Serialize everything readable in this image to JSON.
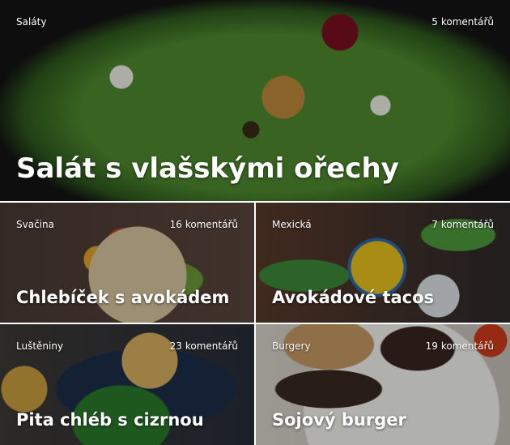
{
  "cards": [
    {
      "category": "Saláty",
      "comments_count": "5",
      "comments_word": "komentářů",
      "title": "Salát s vlašskými ořechy"
    },
    {
      "category": "Svačina",
      "comments_count": "16",
      "comments_word": "komentářů",
      "title": "Chlebíček s avokádem"
    },
    {
      "category": "Mexická",
      "comments_count": "7",
      "comments_word": "komentářů",
      "title": "Avokádové tacos"
    },
    {
      "category": "Luštěniny",
      "comments_count": "23",
      "comments_word": "komentářů",
      "title": "Pita chléb s cizrnou"
    },
    {
      "category": "Burgery",
      "comments_count": "19",
      "comments_word": "komentářů",
      "title": "Sojový burger"
    }
  ]
}
